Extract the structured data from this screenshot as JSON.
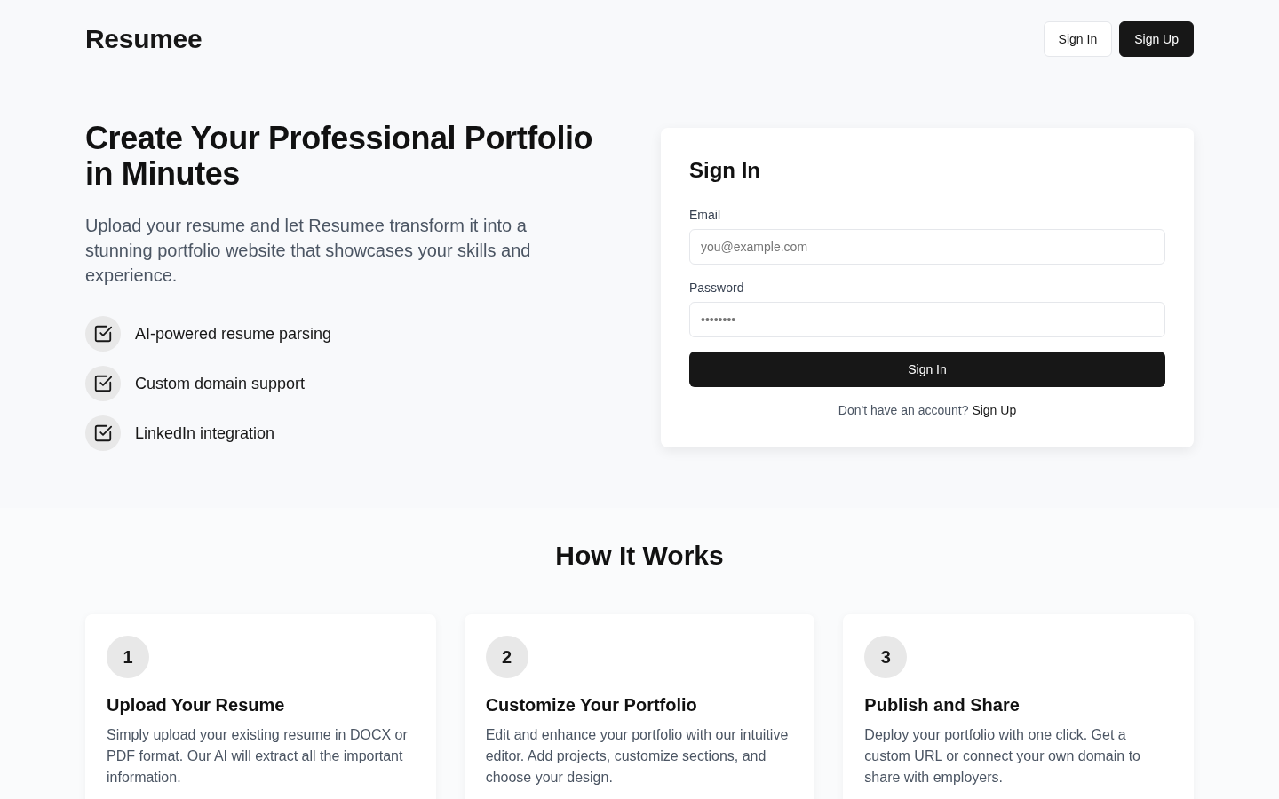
{
  "header": {
    "logo": "Resumee",
    "buttons": [
      {
        "label": "Sign In",
        "kind": "outline"
      },
      {
        "label": "Sign Up",
        "kind": "solid"
      }
    ]
  },
  "hero": {
    "title": "Create Your Professional Portfolio in Minutes",
    "subtitle": "Upload your resume and let Resumee transform it into a stunning portfolio website that showcases your skills and experience.",
    "features": [
      "AI-powered resume parsing",
      "Custom domain support",
      "LinkedIn integration"
    ]
  },
  "sign_in_card": {
    "title": "Sign In",
    "fields": [
      {
        "label": "Email",
        "placeholder": "you@example.com"
      },
      {
        "label": "Password",
        "placeholder": "••••••••"
      }
    ],
    "submit": "Sign In",
    "footer": {
      "text": "Don't have an account?",
      "link": "Sign Up"
    }
  },
  "how_it_works": {
    "title": "How It Works",
    "steps": [
      {
        "number": "1",
        "title": "Upload Your Resume",
        "description": "Simply upload your existing resume in DOCX or PDF format. Our AI will extract all the important information."
      },
      {
        "number": "2",
        "title": "Customize Your Portfolio",
        "description": "Edit and enhance your portfolio with our intuitive editor. Add projects, customize sections, and choose your design."
      },
      {
        "number": "3",
        "title": "Publish and Share",
        "description": "Deploy your portfolio with one click. Get a custom URL or connect your own domain to share with employers."
      }
    ]
  }
}
